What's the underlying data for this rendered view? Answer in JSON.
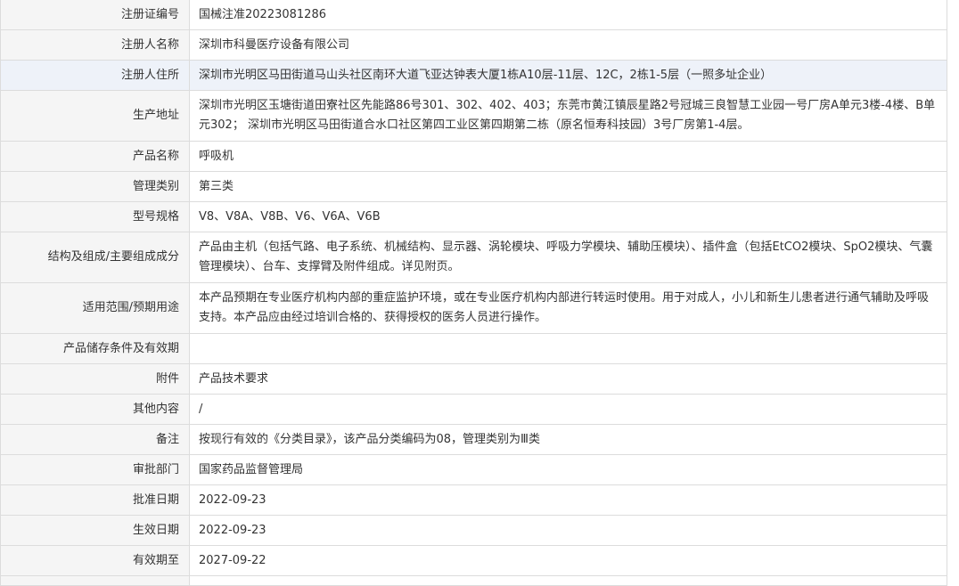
{
  "rows": [
    {
      "label": "注册证编号",
      "value": "国械注准20223081286"
    },
    {
      "label": "注册人名称",
      "value": "深圳市科曼医疗设备有限公司"
    },
    {
      "label": "注册人住所",
      "value": "深圳市光明区马田街道马山头社区南环大道飞亚达钟表大厦1栋A10层-11层、12C，2栋1-5层（一照多址企业）"
    },
    {
      "label": "生产地址",
      "value": "深圳市光明区玉塘街道田寮社区先能路86号301、302、402、403；东莞市黄江镇辰星路2号冠城三良智慧工业园一号厂房A单元3楼-4楼、B单元302； 深圳市光明区马田街道合水口社区第四工业区第四期第二栋（原名恒寿科技园）3号厂房第1-4层。"
    },
    {
      "label": "产品名称",
      "value": "呼吸机"
    },
    {
      "label": "管理类别",
      "value": "第三类"
    },
    {
      "label": "型号规格",
      "value": "V8、V8A、V8B、V6、V6A、V6B"
    },
    {
      "label": "结构及组成/主要组成成分",
      "value": "产品由主机（包括气路、电子系统、机械结构、显示器、涡轮模块、呼吸力学模块、辅助压模块）、插件盒（包括EtCO2模块、SpO2模块、气囊管理模块）、台车、支撑臂及附件组成。详见附页。"
    },
    {
      "label": "适用范围/预期用途",
      "value": "本产品预期在专业医疗机构内部的重症监护环境，或在专业医疗机构内部进行转运时使用。用于对成人，小儿和新生儿患者进行通气辅助及呼吸支持。本产品应由经过培训合格的、获得授权的医务人员进行操作。"
    },
    {
      "label": "产品储存条件及有效期",
      "value": ""
    },
    {
      "label": "附件",
      "value": "产品技术要求"
    },
    {
      "label": "其他内容",
      "value": "/"
    },
    {
      "label": "备注",
      "value": "按现行有效的《分类目录》，该产品分类编码为08，管理类别为Ⅲ类"
    },
    {
      "label": "审批部门",
      "value": "国家药品监督管理局"
    },
    {
      "label": "批准日期",
      "value": "2022-09-23"
    },
    {
      "label": "生效日期",
      "value": "2022-09-23"
    },
    {
      "label": "有效期至",
      "value": "2027-09-22"
    }
  ]
}
